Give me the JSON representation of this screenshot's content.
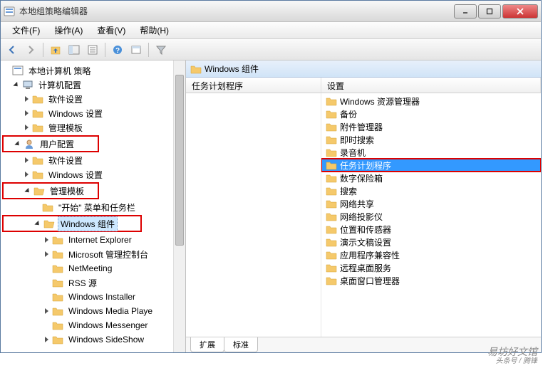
{
  "window": {
    "title": "本地组策略编辑器"
  },
  "menu": {
    "file": "文件(F)",
    "action": "操作(A)",
    "view": "查看(V)",
    "help": "帮助(H)"
  },
  "tree": {
    "root": "本地计算机 策略",
    "computer_config": "计算机配置",
    "user_config": "用户配置",
    "software_settings": "软件设置",
    "windows_settings": "Windows 设置",
    "admin_templates": "管理模板",
    "start_menu": "\"开始\" 菜单和任务栏",
    "windows_components": "Windows 组件",
    "ie": "Internet Explorer",
    "mmc": "Microsoft 管理控制台",
    "netmeeting": "NetMeeting",
    "rss": "RSS 源",
    "installer": "Windows Installer",
    "media_player": "Windows Media Playe",
    "messenger": "Windows Messenger",
    "sideshow": "Windows SideShow"
  },
  "right": {
    "header": "Windows 组件",
    "col1": "任务计划程序",
    "col2": "设置",
    "items": [
      "Windows 资源管理器",
      "备份",
      "附件管理器",
      "即时搜索",
      "录音机",
      "任务计划程序",
      "数字保险箱",
      "搜索",
      "网络共享",
      "网络投影仪",
      "位置和传感器",
      "演示文稿设置",
      "应用程序兼容性",
      "远程桌面服务",
      "桌面窗口管理器"
    ]
  },
  "tabs": {
    "extended": "扩展",
    "standard": "标准"
  },
  "watermark": {
    "main": "易坊好文馆",
    "sub": "头条号 / 腾锋"
  }
}
